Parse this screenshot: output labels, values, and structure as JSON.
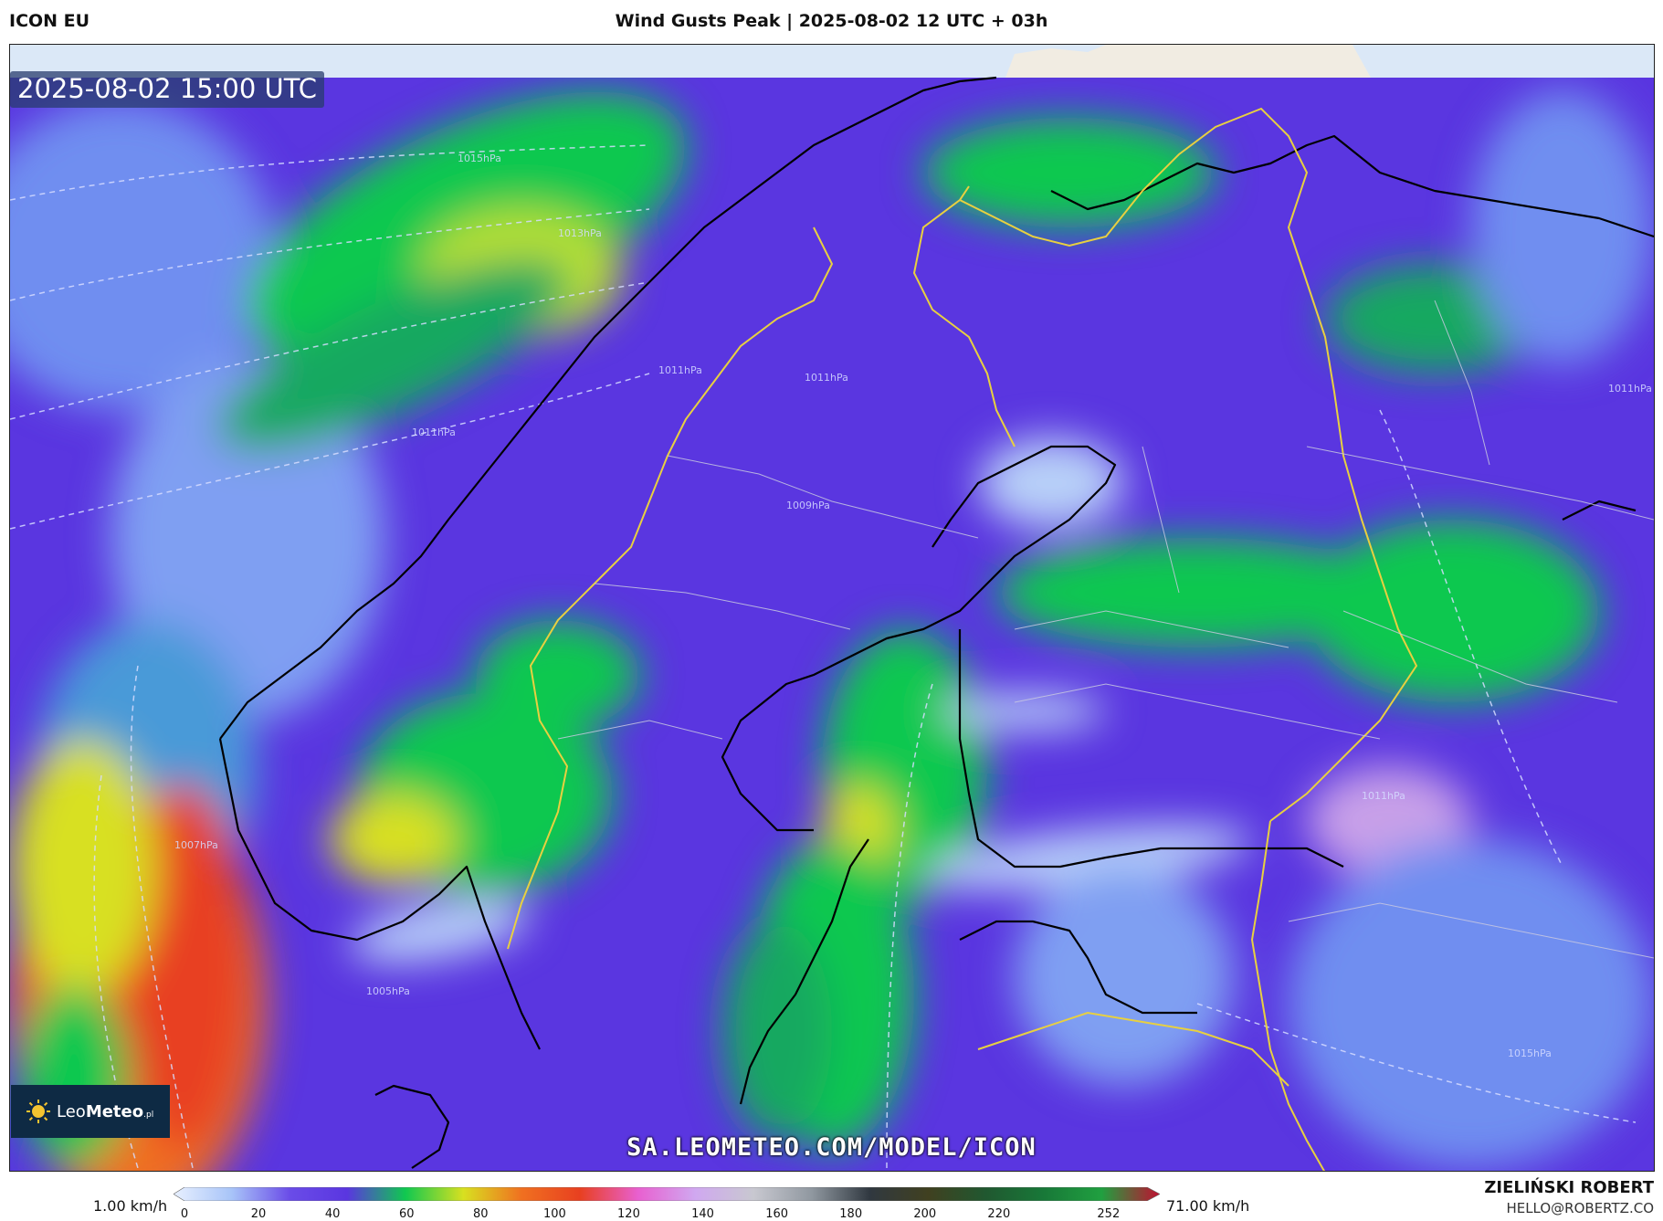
{
  "header": {
    "model": "ICON EU",
    "title": "Wind Gusts Peak | 2025-08-02 12 UTC + 03h"
  },
  "map": {
    "timestamp": "2025-08-02 15:00 UTC",
    "watermark": "SA.LEOMETEO.COM/MODEL/ICON",
    "isobars": [
      "1015hPa",
      "1013hPa",
      "1011hPa",
      "1011hPa",
      "1011hPa",
      "1009hPa",
      "1007hPa",
      "1005hPa",
      "1011hPa",
      "1011hPa",
      "1015hPa"
    ],
    "colors": {
      "land_top": "#f1ece2",
      "ocean_top": "#dbe8f7",
      "base_purple": "#5a36e0",
      "green": "#10c850",
      "yellow": "#d8e020",
      "orange": "#f07020",
      "red": "#e84020",
      "light_blue": "#b8d0f8",
      "border_yellow": "#e8d040"
    }
  },
  "logo": {
    "brand_light": "Leo",
    "brand_bold": "Meteo",
    "suffix": ".pl",
    "icon": "sun-icon"
  },
  "legend": {
    "min_label": "1.00 km/h",
    "max_label": "71.00 km/h",
    "ticks": [
      "0",
      "20",
      "40",
      "60",
      "80",
      "100",
      "120",
      "140",
      "160",
      "180",
      "200",
      "220",
      "252"
    ],
    "stops": [
      "#e8f0ff",
      "#a8c4f8",
      "#6a4ce8",
      "#5a36e0",
      "#10c850",
      "#d8e020",
      "#f07020",
      "#e84020",
      "#e860d0",
      "#d0a8f0",
      "#c8c8d0",
      "#9098a0",
      "#303840",
      "#404020",
      "#205830",
      "#187838",
      "#20a040",
      "#c01030"
    ]
  },
  "credits": {
    "author": "ZIELIŃSKI ROBERT",
    "email": "HELLO@ROBERTZ.CO"
  }
}
